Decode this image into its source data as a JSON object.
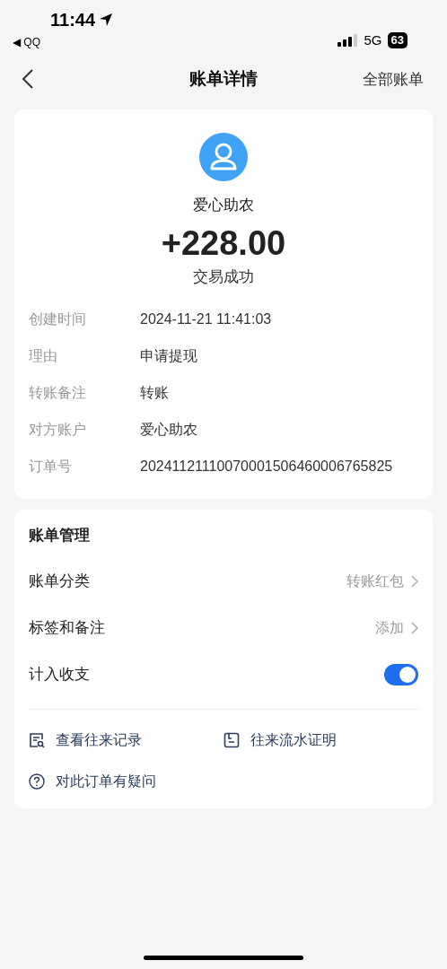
{
  "status_bar": {
    "time": "11:44",
    "back_app": "◀ QQ",
    "network": "5G",
    "battery": "63"
  },
  "nav": {
    "title": "账单详情",
    "action": "全部账单"
  },
  "summary": {
    "name": "爱心助农",
    "amount": "+228.00",
    "status": "交易成功"
  },
  "details": [
    {
      "label": "创建时间",
      "value": "2024-11-21 11:41:03"
    },
    {
      "label": "理由",
      "value": "申请提现"
    },
    {
      "label": "转账备注",
      "value": "转账"
    },
    {
      "label": "对方账户",
      "value": "爱心助农"
    },
    {
      "label": "订单号",
      "value": "20241121110070001506460006765825"
    }
  ],
  "management": {
    "title": "账单管理",
    "rows": [
      {
        "kind": "link",
        "label": "账单分类",
        "value": "转账红包"
      },
      {
        "kind": "link",
        "label": "标签和备注",
        "value": "添加"
      },
      {
        "kind": "toggle",
        "label": "计入收支",
        "checked": true
      }
    ],
    "actions": [
      {
        "kind": "records",
        "label": "查看往来记录"
      },
      {
        "kind": "proof",
        "label": "往来流水证明"
      },
      {
        "kind": "question",
        "label": "对此订单有疑问"
      }
    ]
  }
}
